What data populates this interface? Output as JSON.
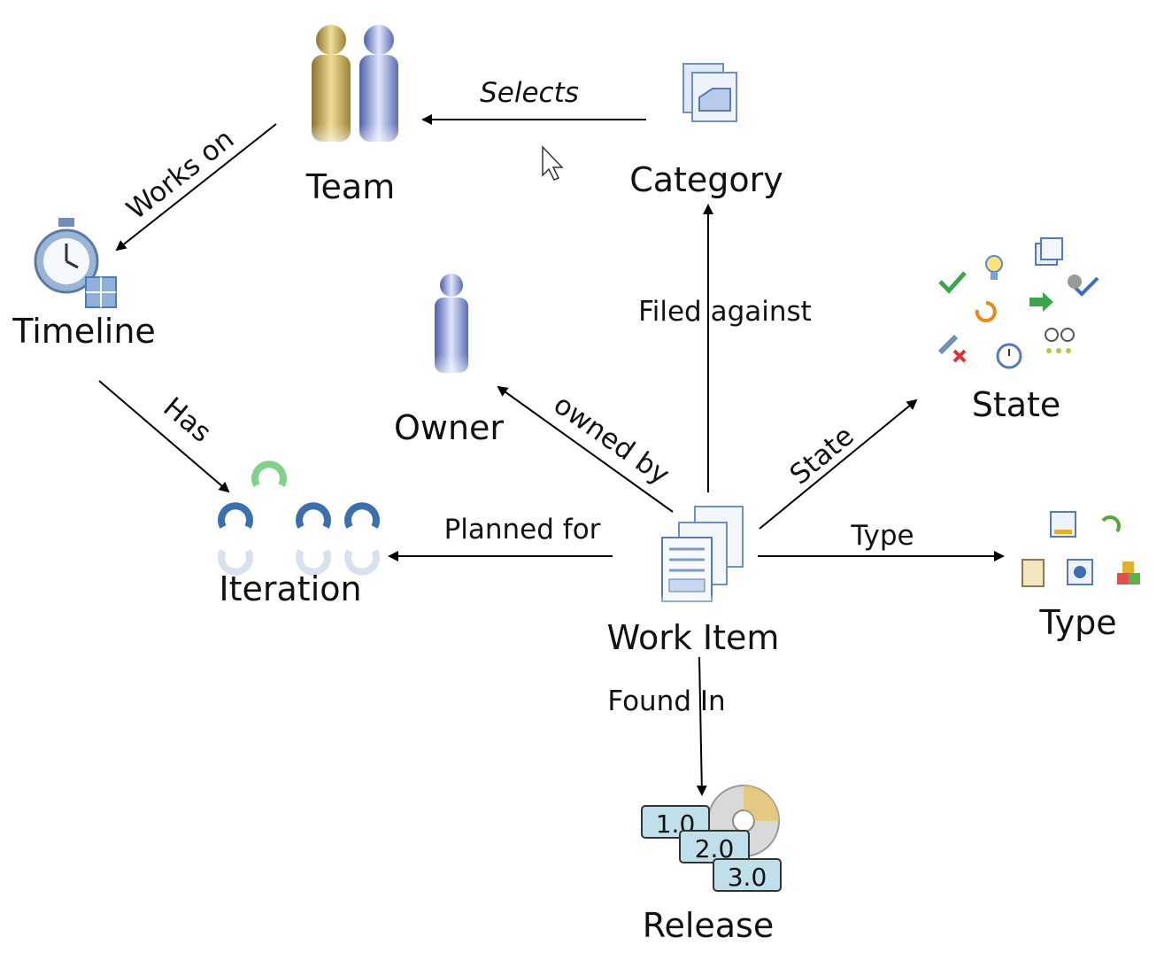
{
  "nodes": {
    "team": "Team",
    "category": "Category",
    "timeline": "Timeline",
    "owner": "Owner",
    "state": "State",
    "iteration": "Iteration",
    "work_item": "Work Item",
    "type": "Type",
    "release": "Release"
  },
  "release_versions": [
    "1.0",
    "2.0",
    "3.0"
  ],
  "edges": {
    "selects": "Selects",
    "works_on": "Works on",
    "has": "Has",
    "filed_against": "Filed against",
    "owned_by": "owned by",
    "state": "State",
    "planned_for": "Planned for",
    "type": "Type",
    "found_in": "Found In"
  },
  "colors": {
    "team_member_gold": "#c8a84a",
    "team_member_blue": "#7d8fcf",
    "icon_blue": "#4a7ab8",
    "iteration_green": "#6cc47a",
    "release_tag": "#bfe0ea"
  }
}
